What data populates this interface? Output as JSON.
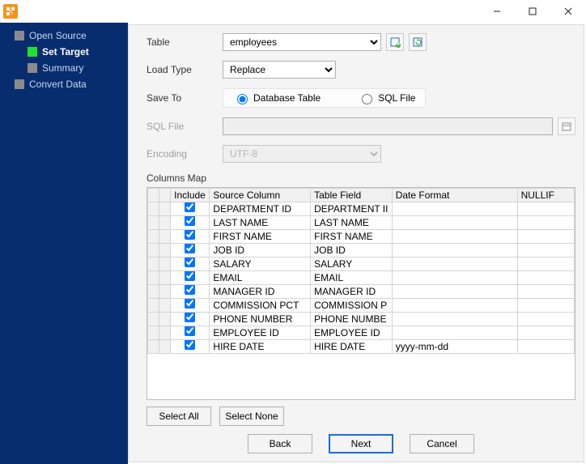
{
  "titlebar": {
    "min": "—",
    "max": "▢",
    "close": "✕"
  },
  "sidebar": {
    "items": [
      {
        "label": "Open Source"
      },
      {
        "label": "Set Target"
      },
      {
        "label": "Summary"
      },
      {
        "label": "Convert Data"
      }
    ]
  },
  "form": {
    "table_lbl": "Table",
    "table_val": "employees",
    "loadtype_lbl": "Load Type",
    "loadtype_val": "Replace",
    "saveto_lbl": "Save To",
    "saveto_opts": {
      "db": "Database Table",
      "sql": "SQL File"
    },
    "sqlfile_lbl": "SQL File",
    "sqlfile_val": "",
    "encoding_lbl": "Encoding",
    "encoding_val": "UTF-8",
    "columns_title": "Columns Map"
  },
  "grid": {
    "headers": {
      "include": "Include",
      "source": "Source Column",
      "field": "Table Field",
      "date": "Date Format",
      "nullif": "NULLIF"
    },
    "rows": [
      {
        "src": "DEPARTMENT ID",
        "field": "DEPARTMENT II",
        "date": "",
        "nullif": ""
      },
      {
        "src": "LAST NAME",
        "field": "LAST NAME",
        "date": "",
        "nullif": ""
      },
      {
        "src": "FIRST NAME",
        "field": "FIRST NAME",
        "date": "",
        "nullif": ""
      },
      {
        "src": "JOB ID",
        "field": "JOB ID",
        "date": "",
        "nullif": ""
      },
      {
        "src": "SALARY",
        "field": "SALARY",
        "date": "",
        "nullif": ""
      },
      {
        "src": "EMAIL",
        "field": "EMAIL",
        "date": "",
        "nullif": ""
      },
      {
        "src": "MANAGER ID",
        "field": "MANAGER ID",
        "date": "",
        "nullif": ""
      },
      {
        "src": "COMMISSION PCT",
        "field": "COMMISSION P",
        "date": "",
        "nullif": ""
      },
      {
        "src": "PHONE NUMBER",
        "field": "PHONE NUMBE",
        "date": "",
        "nullif": ""
      },
      {
        "src": "EMPLOYEE ID",
        "field": "EMPLOYEE ID",
        "date": "",
        "nullif": ""
      },
      {
        "src": "HIRE DATE",
        "field": "HIRE DATE",
        "date": "yyyy-mm-dd",
        "nullif": ""
      }
    ]
  },
  "buttons": {
    "select_all": "Select All",
    "select_none": "Select None",
    "back": "Back",
    "next": "Next",
    "cancel": "Cancel"
  }
}
